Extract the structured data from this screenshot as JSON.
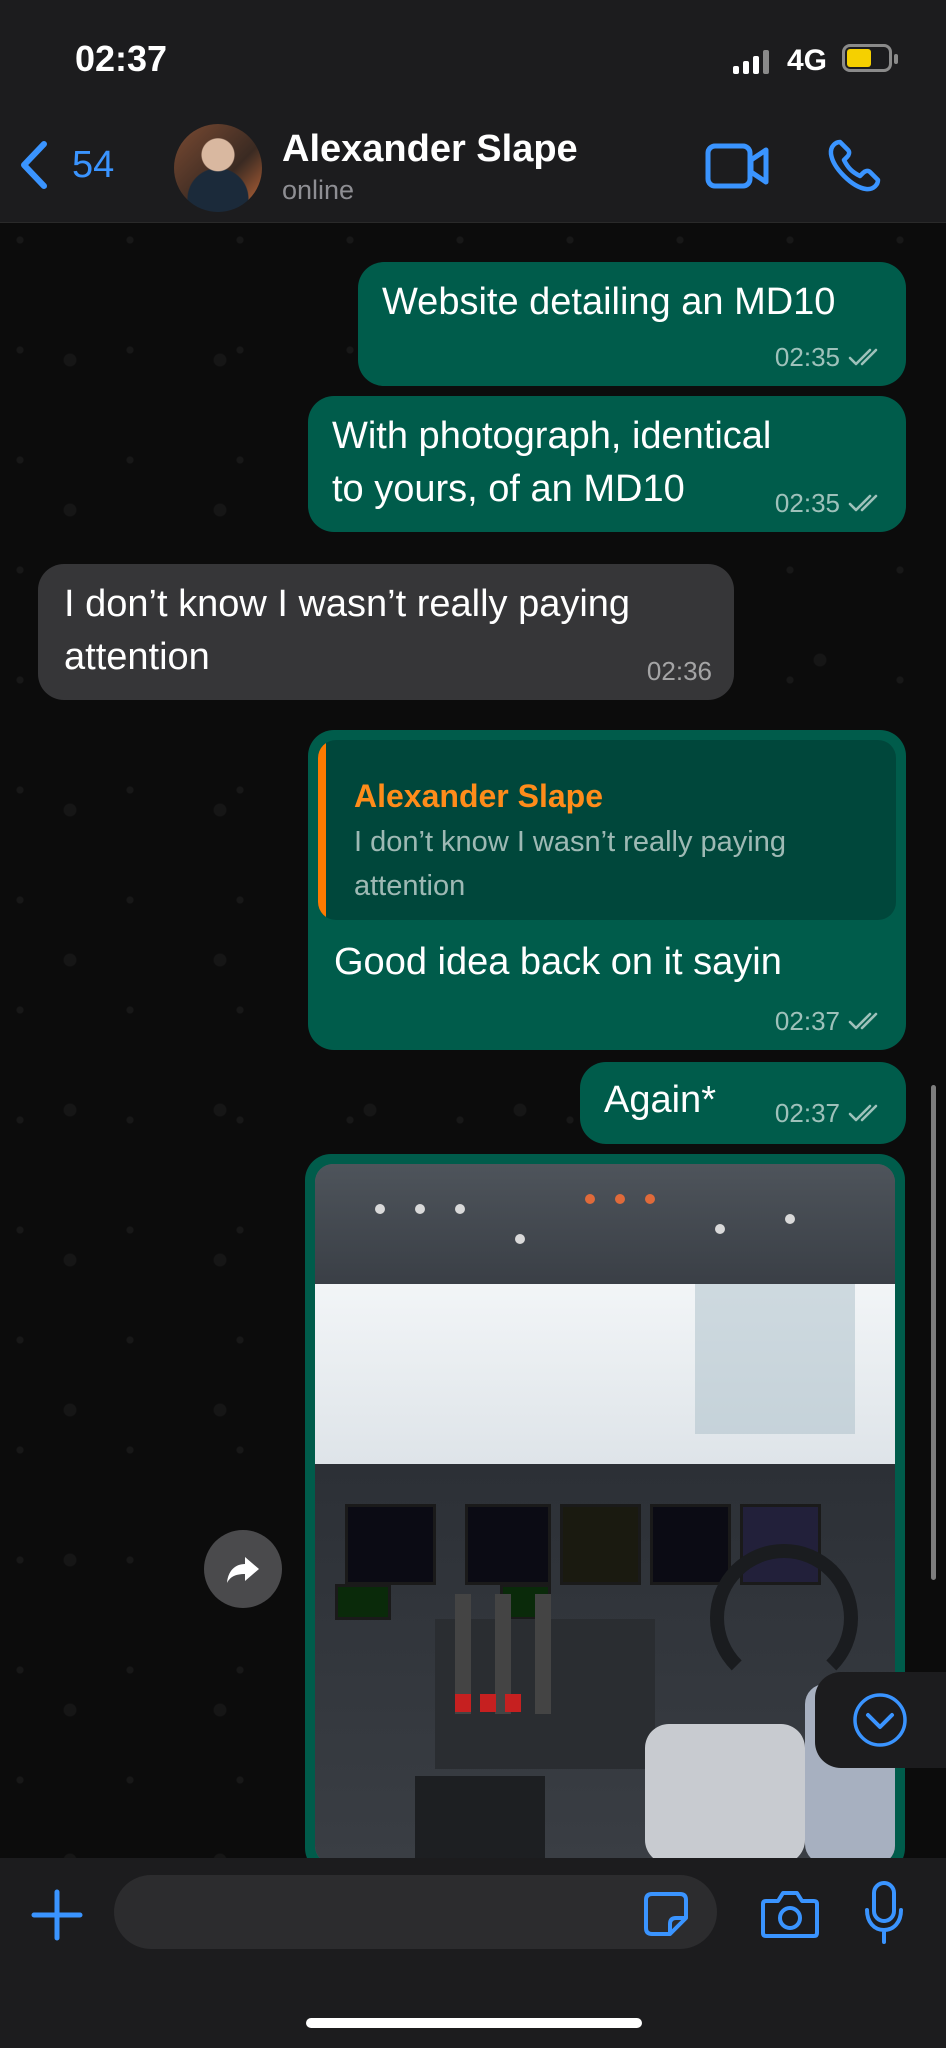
{
  "status_bar": {
    "time": "02:37",
    "network": "4G"
  },
  "header": {
    "back_count": "54",
    "contact_name": "Alexander Slape",
    "contact_status": "online"
  },
  "colors": {
    "accent": "#3a94ff",
    "outgoing_bubble": "#005c4b",
    "incoming_bubble": "#363638",
    "reply_name": "#ff8c1a"
  },
  "messages": [
    {
      "direction": "out",
      "text": "Website detailing an MD10",
      "time": "02:35"
    },
    {
      "direction": "out",
      "text": "With photograph, identical to yours, of an MD10",
      "time": "02:35"
    },
    {
      "direction": "in",
      "text": "I don’t know I wasn’t really paying attention",
      "time": "02:36"
    },
    {
      "direction": "out",
      "reply_to": {
        "name": "Alexander Slape",
        "text": "I don’t know I wasn’t really paying attention"
      },
      "text": "Good idea back on it sayin",
      "time": "02:37"
    },
    {
      "direction": "out",
      "text": "Again*",
      "time": "02:37"
    },
    {
      "direction": "out",
      "type": "image",
      "subject": "aircraft cockpit photo"
    }
  ],
  "composer": {
    "placeholder": ""
  },
  "icons": [
    "chevron-left-icon",
    "video-icon",
    "phone-icon",
    "forward-icon",
    "chevron-down-icon",
    "plus-icon",
    "sticker-icon",
    "camera-icon",
    "microphone-icon"
  ]
}
